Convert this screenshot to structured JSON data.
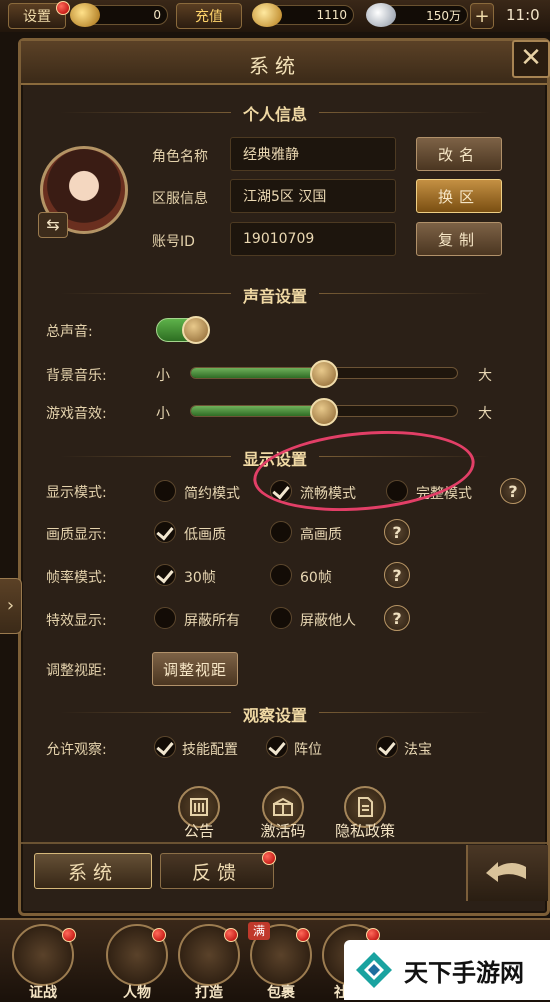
{
  "top_bar": {
    "settings_label": "设置",
    "coin_value": "0",
    "recharge_label": "充值",
    "gold_value": "1110",
    "silver_value": "150万",
    "plus_label": "+",
    "time_text": "11:0"
  },
  "panel": {
    "title": "系统",
    "close_label": "✕"
  },
  "personal_info": {
    "section_title": "个人信息",
    "role_name_label": "角色名称",
    "role_name_value": "经典雅静",
    "rename_button": "改名",
    "server_label": "区服信息",
    "server_value": "江湖5区 汉国",
    "switch_server_button": "换区",
    "account_label": "账号ID",
    "account_value": "19010709",
    "copy_button": "复制"
  },
  "sound_settings": {
    "section_title": "声音设置",
    "master_label": "总声音:",
    "bgm_label": "背景音乐:",
    "sfx_label": "游戏音效:",
    "small_label": "小",
    "large_label": "大",
    "master_on": true,
    "bgm_level": 0.5,
    "sfx_level": 0.5
  },
  "display_settings": {
    "section_title": "显示设置",
    "mode_label": "显示模式:",
    "mode_options": [
      "简约模式",
      "流畅模式",
      "完整模式"
    ],
    "quality_label": "画质显示:",
    "quality_options": [
      "低画质",
      "高画质"
    ],
    "fps_label": "帧率模式:",
    "fps_options": [
      "30帧",
      "60帧"
    ],
    "effects_label": "特效显示:",
    "effects_options": [
      "屏蔽所有",
      "屏蔽他人"
    ],
    "view_label": "调整视距:",
    "view_button": "调整视距",
    "help_label": "?"
  },
  "observe_settings": {
    "section_title": "观察设置",
    "allow_label": "允许观察:",
    "options": [
      "技能配置",
      "阵位",
      "法宝"
    ]
  },
  "bottom_icons": [
    "公告",
    "激活码",
    "隐私政策"
  ],
  "bottom_tabs": {
    "system": "系统",
    "feedback": "反馈"
  },
  "nav": {
    "items": [
      "证战",
      "人物",
      "打造",
      "包裹",
      "社"
    ],
    "full_badge": "满"
  },
  "watermark": {
    "text": "天下手游网"
  }
}
